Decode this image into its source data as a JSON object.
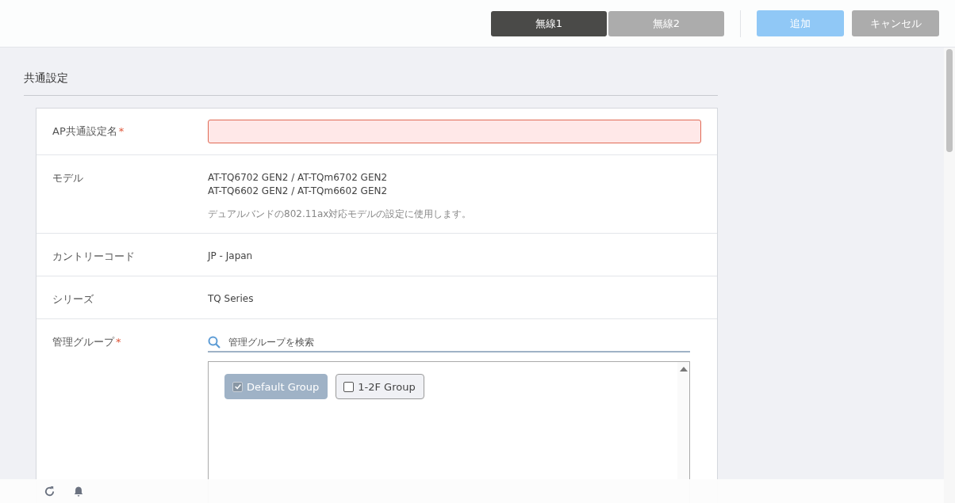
{
  "tabs": [
    {
      "label": "無線1",
      "selected": true
    },
    {
      "label": "無線2",
      "selected": false
    }
  ],
  "actions": [
    {
      "label": "追加",
      "kind": "primary"
    },
    {
      "label": "キャンセル",
      "kind": "secondary"
    }
  ],
  "section": {
    "title": "共通設定"
  },
  "rows": [
    {
      "kind": "input",
      "label": "AP共通設定名",
      "required_mark": "*",
      "invalid": true
    },
    {
      "kind": "text",
      "label": "モデル",
      "lines": [
        "AT-TQ6702 GEN2 / AT-TQm6702 GEN2",
        "AT-TQ6602 GEN2 / AT-TQm6602 GEN2"
      ],
      "note": "デュアルバンドの802.11ax対応モデルの設定に使用します。"
    },
    {
      "kind": "text",
      "label": "カントリーコード",
      "lines": [
        "JP - Japan"
      ]
    },
    {
      "kind": "text",
      "label": "シリーズ",
      "lines": [
        "TQ Series"
      ]
    },
    {
      "kind": "groups",
      "label": "管理グループ",
      "required_mark": "*",
      "placeholder": "管理グループを検索",
      "groups": [
        {
          "label": "Default Group",
          "checked": true,
          "disabled": true
        },
        {
          "label": "1-2F Group",
          "checked": false,
          "disabled": false
        }
      ]
    }
  ]
}
